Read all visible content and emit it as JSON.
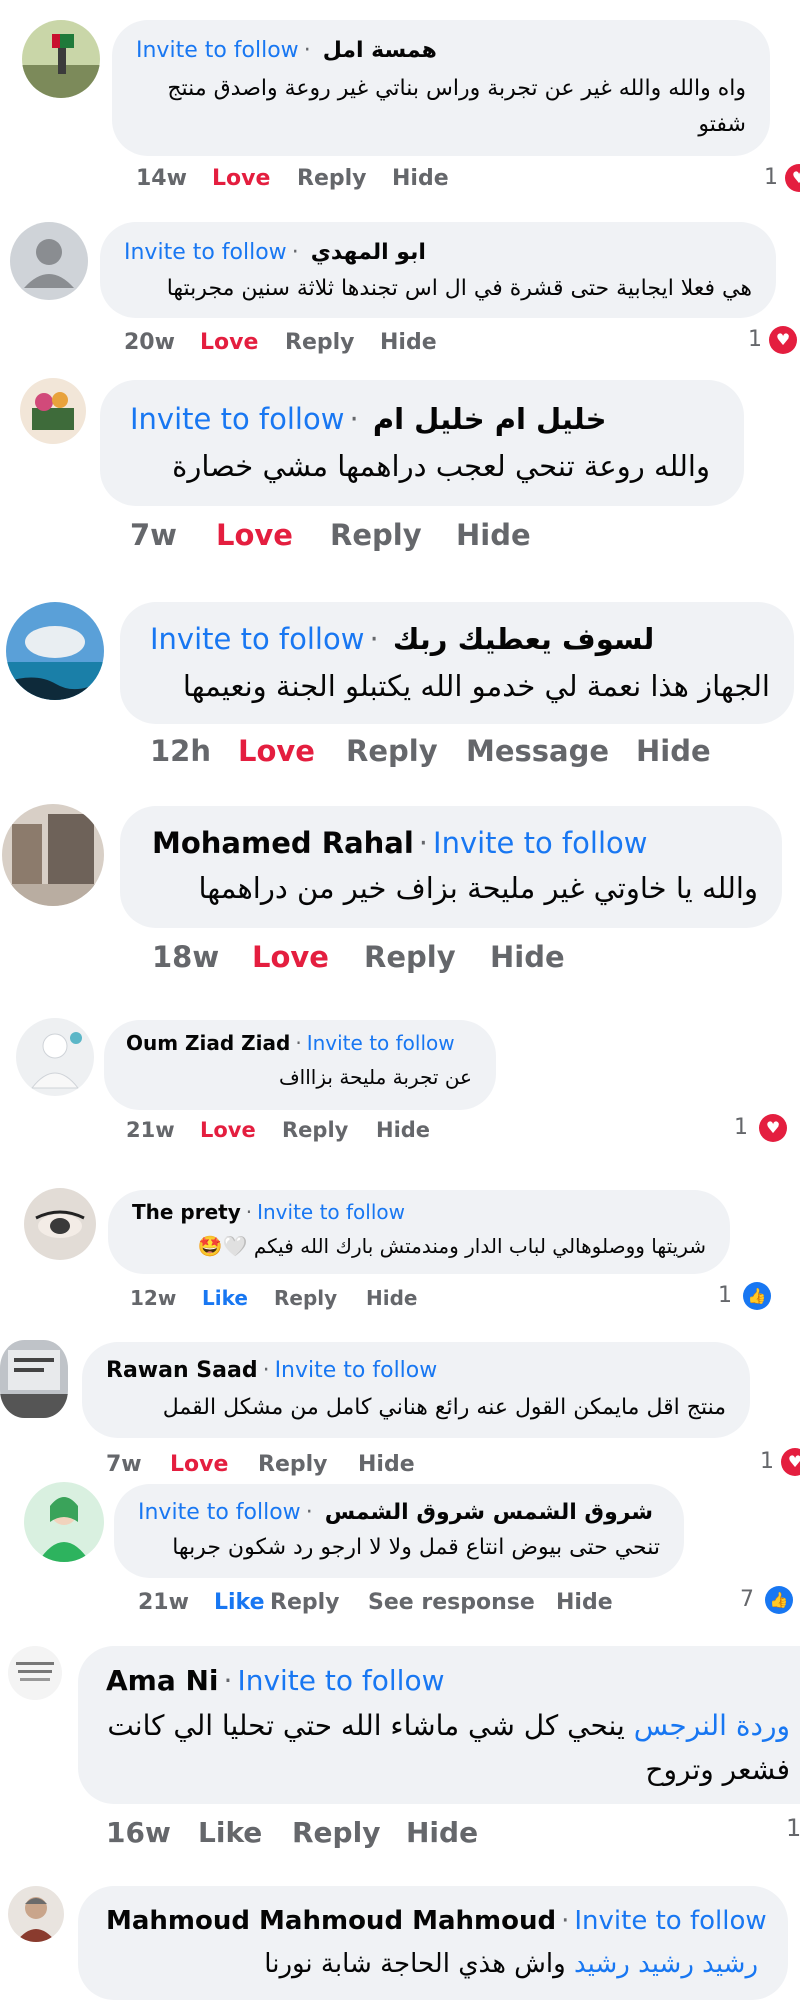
{
  "comments": [
    {
      "name": "همسة امل",
      "invite": "Invite to follow",
      "text_l1": "واه والله والله غير عن تجربة وراس بناتي غير روعة واصدق منتج",
      "text_l2": "شفتو",
      "time": "14w",
      "love": "Love",
      "reply": "Reply",
      "hide": "Hide",
      "count": "1"
    },
    {
      "name": "ابو المهدي",
      "invite": "Invite to follow",
      "text": "هي فعلا ايجابية  حتى قشرة في ال اس تجندها ثلاثة سنين مجربتها",
      "time": "20w",
      "love": "Love",
      "reply": "Reply",
      "hide": "Hide",
      "count": "1"
    },
    {
      "name": "خليل ام خليل ام",
      "invite": "Invite to follow",
      "text": "والله روعة تنحي لعجب  دراهمها مشي خصارة",
      "time": "7w",
      "love": "Love",
      "reply": "Reply",
      "hide": "Hide"
    },
    {
      "name": "لسوف  يعطيك  ربك",
      "invite": "Invite to follow",
      "text": "الجهاز هذا نعمة لي خدمو الله يكتبلو الجنة ونعيمها",
      "time": "12h",
      "love": "Love",
      "reply": "Reply",
      "message": "Message",
      "hide": "Hide"
    },
    {
      "name": "Mohamed Rahal",
      "invite": "Invite to follow",
      "text": "والله يا خاوتي غير مليحة بزاف  خير من دراهمها",
      "time": "18w",
      "love": "Love",
      "reply": "Reply",
      "hide": "Hide"
    },
    {
      "name": "Oum Ziad Ziad",
      "invite": "Invite to follow",
      "text": "عن تجربة مليحة بزاااف",
      "time": "21w",
      "love": "Love",
      "reply": "Reply",
      "hide": "Hide",
      "count": "1"
    },
    {
      "name": "The prety",
      "invite": "Invite to follow",
      "text": "شريتها ووصلوهالي لباب الدار ومندمتش بارك الله فيكم",
      "emoji": "🤍🤩",
      "time": "12w",
      "like": "Like",
      "reply": "Reply",
      "hide": "Hide",
      "count": "1"
    },
    {
      "name": "Rawan Saad",
      "invite": "Invite to follow",
      "text": "منتج اقل مايمكن القول عنه رائع هناني كامل من مشكل القمل",
      "time": "7w",
      "love": "Love",
      "reply": "Reply",
      "hide": "Hide",
      "count": "1"
    },
    {
      "name": "شروق الشمس  شروق الشمس",
      "invite": "Invite to follow",
      "text": "تنحي حتى بيوض انتاع قمل ولا لا ارجو رد شكون جربها",
      "time": "21w",
      "like": "Like",
      "reply": "Reply",
      "see_response": "See response",
      "hide": "Hide",
      "count": "7"
    },
    {
      "name": "Ama Ni",
      "invite": "Invite to follow",
      "mention": "وردة النرجس",
      "text_l1": "ينحي كل شي ماشاء الله   حتي تحليا الي كانت",
      "text_l2": "فشعر وتروح",
      "time": "16w",
      "like": "Like",
      "reply": "Reply",
      "hide": "Hide",
      "count": "1"
    },
    {
      "name": "Mahmoud Mahmoud Mahmoud",
      "invite": "Invite to follow",
      "mention": "رشيد رشيد رشيد",
      "text": "واش هذي الحاجة شابة نورنا"
    }
  ],
  "colors": {
    "link": "#1877f2",
    "love": "#e41e3f",
    "bubble": "#f0f2f5",
    "meta": "#65676b"
  }
}
